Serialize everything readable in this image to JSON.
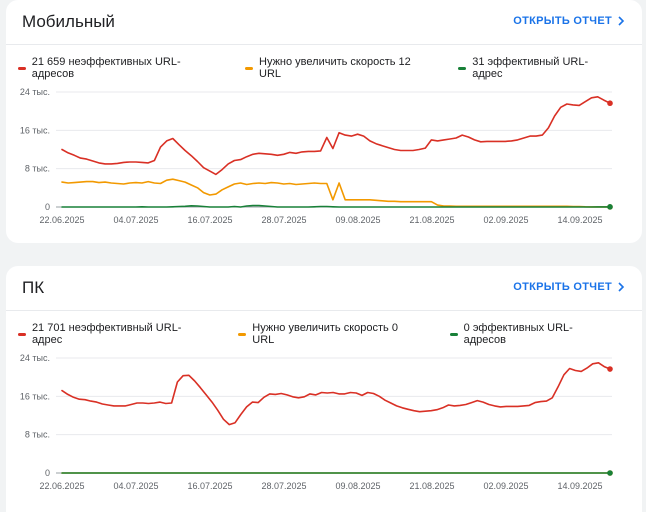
{
  "colors": {
    "ineffective": "#d93025",
    "improve": "#f29900",
    "effective": "#188038",
    "link": "#1a73e8"
  },
  "cards": [
    {
      "title": "Мобильный",
      "open_report": "ОТКРЫТЬ ОТЧЕТ",
      "legend": [
        "21 659 неэффективных URL-адресов",
        "Нужно увеличить скорость 12 URL",
        "31 эффективный URL-адрес"
      ]
    },
    {
      "title": "ПК",
      "open_report": "ОТКРЫТЬ ОТЧЕТ",
      "legend": [
        "21 701 неэффективный URL-адрес",
        "Нужно увеличить скорость 0 URL",
        "0 эффективных URL-адресов"
      ]
    }
  ],
  "chart_data": [
    {
      "type": "line",
      "x_ticks": [
        "22.06.2025",
        "04.07.2025",
        "16.07.2025",
        "28.07.2025",
        "09.08.2025",
        "21.08.2025",
        "02.09.2025",
        "14.09.2025"
      ],
      "y_ticks": [
        "0",
        "8 тыс.",
        "16 тыс.",
        "24 тыс."
      ],
      "ylim": [
        0,
        24000
      ],
      "x_count": 88,
      "series": [
        {
          "name": "21 659 неэффективных URL-адресов",
          "color_key": "ineffective",
          "values": [
            12000,
            11300,
            10800,
            10200,
            10000,
            9600,
            9200,
            9000,
            9000,
            9100,
            9300,
            9400,
            9400,
            9300,
            9200,
            9700,
            12500,
            13800,
            14300,
            13000,
            11800,
            10700,
            9500,
            8200,
            7500,
            6800,
            7800,
            9000,
            9700,
            9900,
            10500,
            11000,
            11200,
            11100,
            11000,
            10800,
            11000,
            11400,
            11200,
            11500,
            11600,
            11600,
            11700,
            14500,
            12200,
            15500,
            15000,
            14800,
            15200,
            14800,
            13800,
            13200,
            12800,
            12400,
            12000,
            11800,
            11800,
            11800,
            12000,
            12300,
            14000,
            13800,
            14000,
            14200,
            14400,
            15000,
            14600,
            14000,
            13600,
            13700,
            13700,
            13700,
            13700,
            13800,
            14000,
            14400,
            14800,
            14800,
            15000,
            16500,
            19000,
            20800,
            21500,
            21300,
            21200,
            22000,
            22800,
            23000,
            22300,
            21659
          ]
        },
        {
          "name": "Нужно увеличить скорость 12 URL",
          "color_key": "improve",
          "values": [
            5200,
            5000,
            5100,
            5200,
            5300,
            5300,
            5100,
            5200,
            5000,
            4900,
            4800,
            5000,
            5100,
            5000,
            5300,
            5000,
            4900,
            5600,
            5800,
            5500,
            5200,
            4600,
            4000,
            3000,
            2500,
            2700,
            3600,
            4200,
            4800,
            5000,
            4700,
            4900,
            5000,
            4900,
            5100,
            5000,
            4800,
            4900,
            4700,
            4800,
            4900,
            5000,
            4900,
            4900,
            1500,
            5000,
            1500,
            1500,
            1500,
            1500,
            1500,
            1400,
            1300,
            1200,
            1200,
            1100,
            1100,
            1100,
            1100,
            1100,
            1100,
            400,
            200,
            200,
            150,
            150,
            150,
            150,
            150,
            150,
            150,
            150,
            150,
            150,
            150,
            150,
            150,
            150,
            150,
            150,
            150,
            150,
            150,
            100,
            100,
            50,
            20,
            12,
            12,
            12
          ]
        },
        {
          "name": "31 эффективный URL-адрес",
          "color_key": "effective",
          "values": [
            0,
            0,
            0,
            0,
            0,
            0,
            0,
            0,
            0,
            0,
            0,
            0,
            0,
            50,
            0,
            0,
            0,
            0,
            50,
            100,
            150,
            250,
            200,
            100,
            0,
            0,
            0,
            0,
            100,
            0,
            200,
            300,
            300,
            200,
            100,
            0,
            0,
            0,
            0,
            0,
            0,
            50,
            100,
            100,
            50,
            0,
            0,
            0,
            0,
            0,
            0,
            0,
            0,
            0,
            0,
            0,
            0,
            0,
            0,
            0,
            0,
            0,
            0,
            0,
            0,
            0,
            0,
            0,
            0,
            0,
            0,
            0,
            0,
            0,
            0,
            0,
            0,
            0,
            0,
            0,
            0,
            0,
            0,
            0,
            0,
            0,
            0,
            31,
            31,
            31
          ]
        }
      ]
    },
    {
      "type": "line",
      "x_ticks": [
        "22.06.2025",
        "04.07.2025",
        "16.07.2025",
        "28.07.2025",
        "09.08.2025",
        "21.08.2025",
        "02.09.2025",
        "14.09.2025"
      ],
      "y_ticks": [
        "0",
        "8 тыс.",
        "16 тыс.",
        "24 тыс."
      ],
      "ylim": [
        0,
        24000
      ],
      "x_count": 88,
      "series": [
        {
          "name": "21 701 неэффективный URL-адрес",
          "color_key": "ineffective",
          "values": [
            17200,
            16400,
            15800,
            15400,
            15300,
            15000,
            14800,
            14400,
            14200,
            14000,
            14000,
            14000,
            14300,
            14600,
            14600,
            14500,
            14600,
            14800,
            14500,
            14600,
            19000,
            20300,
            20400,
            19200,
            17800,
            16300,
            14800,
            13100,
            11200,
            10100,
            10500,
            12200,
            13800,
            14800,
            14700,
            15800,
            16500,
            16400,
            16600,
            16300,
            15900,
            15700,
            15900,
            16500,
            16300,
            16800,
            16700,
            16800,
            16500,
            16500,
            16800,
            16700,
            16200,
            16800,
            16600,
            16000,
            15200,
            14600,
            14000,
            13600,
            13300,
            13000,
            12800,
            12900,
            13000,
            13200,
            13600,
            14200,
            14000,
            14100,
            14300,
            14700,
            15100,
            14800,
            14300,
            14000,
            13800,
            13900,
            13900,
            13900,
            14000,
            14100,
            14700,
            14900,
            15000,
            15700,
            18000,
            20500,
            21800,
            21400,
            21200,
            21900,
            22800,
            23000,
            22200,
            21701
          ]
        },
        {
          "name": "Нужно увеличить скорость 0 URL",
          "color_key": "improve",
          "values": [
            0,
            0
          ]
        },
        {
          "name": "0 эффективных URL-адресов",
          "color_key": "effective",
          "values": [
            0,
            0
          ]
        }
      ]
    }
  ]
}
